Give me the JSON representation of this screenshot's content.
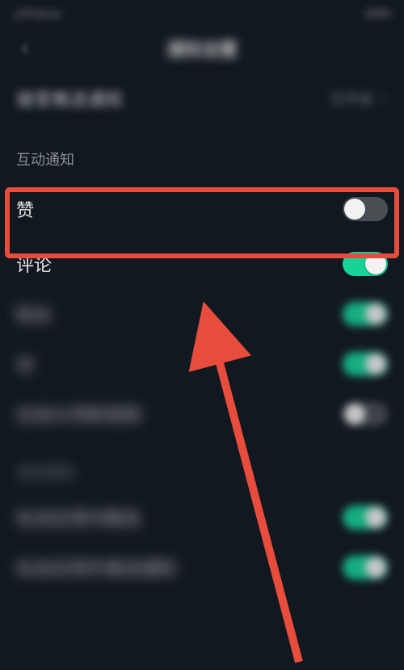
{
  "statusBar": {
    "left": "上午10:14",
    "right": "100%"
  },
  "header": {
    "title": "通知设置"
  },
  "push": {
    "label": "接受推送通知",
    "value": "已开启"
  },
  "sections": {
    "interact": {
      "header": "互动通知",
      "items": {
        "like": {
          "label": "赞",
          "on": false
        },
        "comment": {
          "label": "评论",
          "on": true
        },
        "item3": {
          "label": "粉丝",
          "on": true
        },
        "item4": {
          "label": "@",
          "on": true
        },
        "item5": {
          "label": "在线大师新视频",
          "on": false
        }
      }
    },
    "other": {
      "header": "其他通知",
      "items": {
        "item6": {
          "label": "私信应用内推送",
          "on": true
        },
        "item7": {
          "label": "私信应用外推送通知",
          "on": true
        }
      }
    }
  },
  "annotation": {
    "highlightColor": "#e74c3c"
  }
}
